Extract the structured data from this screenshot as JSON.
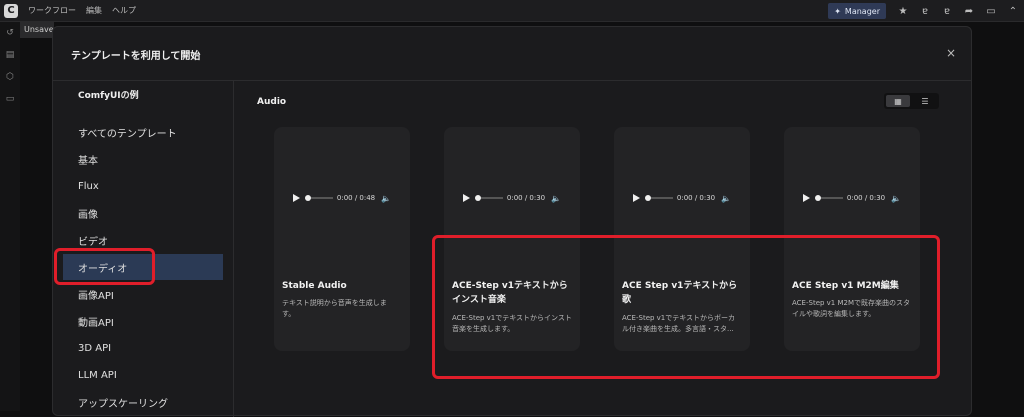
{
  "topbar": {
    "menus": [
      "ワークフロー",
      "編集",
      "ヘルプ"
    ],
    "manager_label": "Manager",
    "icons": [
      "star-icon",
      "translate-icon",
      "translate-icon",
      "share-icon",
      "panel-icon",
      "collapse-icon"
    ]
  },
  "tab": {
    "label": "Unsaved"
  },
  "dialog": {
    "title": "テンプレートを利用して開始",
    "close": "×"
  },
  "sidebar": {
    "title": "ComfyUIの例",
    "items": [
      "すべてのテンプレート",
      "基本",
      "Flux",
      "画像",
      "ビデオ",
      "オーディオ",
      "画像API",
      "動画API",
      "3D API",
      "LLM API",
      "アップスケーリング"
    ],
    "active": "オーディオ"
  },
  "main": {
    "section_title": "Audio",
    "view_modes": [
      "grid-icon",
      "list-icon"
    ],
    "cards": [
      {
        "time": "0:00 / 0:48",
        "progress": 0.0,
        "title": "Stable Audio",
        "description": "テキスト説明から音声を生成しま す。"
      },
      {
        "time": "0:00 / 0:30",
        "progress": 0.0,
        "title": "ACE-Step v1テキストから インスト音楽",
        "description": "ACE-Step v1でテキストからインスト音楽を生成します。"
      },
      {
        "time": "0:00 / 0:30",
        "progress": 0.0,
        "title": "ACE Step v1テキストから 歌",
        "description": "ACE-Step v1でテキストからボーカル付き楽曲を生成。多言語・スタ..."
      },
      {
        "time": "0:00 / 0:30",
        "progress": 0.0,
        "title": "ACE Step v1 M2M編集",
        "description": "ACE-Step v1 M2Mで既存楽曲のスタイルや歌詞を編集します。"
      }
    ]
  },
  "colors": {
    "accent_active": "#2b3a55",
    "highlight": "#e01e2a",
    "manager_button": "#2f3a56"
  }
}
